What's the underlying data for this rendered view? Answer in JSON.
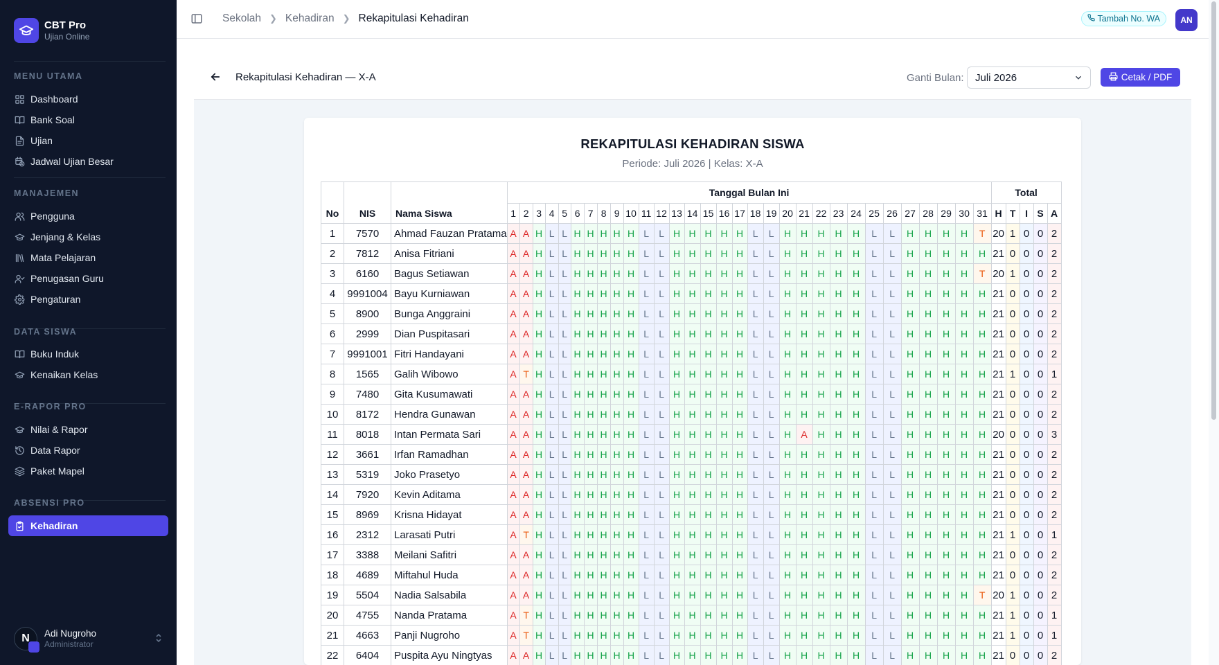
{
  "brand": {
    "title": "CBT Pro",
    "subtitle": "Ujian Online"
  },
  "sidebar": {
    "sections": [
      {
        "title": "MENU UTAMA",
        "items": [
          {
            "label": "Dashboard",
            "icon": "grid-icon"
          },
          {
            "label": "Bank Soal",
            "icon": "book-icon"
          },
          {
            "label": "Ujian",
            "icon": "document-icon"
          },
          {
            "label": "Jadwal Ujian Besar",
            "icon": "calendar-clock-icon"
          }
        ]
      },
      {
        "title": "MANAJEMEN",
        "items": [
          {
            "label": "Pengguna",
            "icon": "users-icon"
          },
          {
            "label": "Jenjang & Kelas",
            "icon": "graduation-cap-icon"
          },
          {
            "label": "Mata Pelajaran",
            "icon": "library-icon"
          },
          {
            "label": "Penugasan Guru",
            "icon": "user-check-icon"
          },
          {
            "label": "Pengaturan",
            "icon": "gear-icon"
          }
        ]
      },
      {
        "title": "DATA SISWA",
        "items": [
          {
            "label": "Buku Induk",
            "icon": "book-icon"
          },
          {
            "label": "Kenaikan Kelas",
            "icon": "graduation-cap-icon"
          }
        ]
      },
      {
        "title": "E-RAPOR PRO",
        "items": [
          {
            "label": "Nilai & Rapor",
            "icon": "graduation-cap-icon"
          },
          {
            "label": "Data Rapor",
            "icon": "history-icon"
          },
          {
            "label": "Paket Mapel",
            "icon": "layers-icon"
          }
        ]
      },
      {
        "title": "ABSENSI PRO",
        "items": [
          {
            "label": "Kehadiran",
            "icon": "clipboard-check-icon",
            "active": true
          }
        ]
      }
    ],
    "user": {
      "initial": "N",
      "name": "Adi Nugroho",
      "role": "Administrator"
    }
  },
  "topbar": {
    "breadcrumb": [
      "Sekolah",
      "Kehadiran",
      "Rekapitulasi Kehadiran"
    ],
    "wa_label": "Tambah No. WA",
    "avatar": "AN"
  },
  "header": {
    "title": "Rekapitulasi Kehadiran — X-A",
    "month_label": "Ganti Bulan:",
    "month_value": "Juli 2026",
    "print_label": "Cetak / PDF"
  },
  "report": {
    "title": "REKAPITULASI KEHADIRAN SISWA",
    "period": "Periode: Juli 2026 | Kelas: X-A",
    "headers": {
      "no": "No",
      "nis": "NIS",
      "name": "Nama Siswa",
      "days_group": "Tanggal Bulan Ini",
      "total_group": "Total"
    },
    "days": [
      "1",
      "2",
      "3",
      "4",
      "5",
      "6",
      "7",
      "8",
      "9",
      "10",
      "11",
      "12",
      "13",
      "14",
      "15",
      "16",
      "17",
      "18",
      "19",
      "20",
      "21",
      "22",
      "23",
      "24",
      "25",
      "26",
      "27",
      "28",
      "29",
      "30",
      "31"
    ],
    "total_keys": [
      "H",
      "T",
      "I",
      "S",
      "A"
    ],
    "rows": [
      {
        "no": "1",
        "nis": "7570",
        "name": "Ahmad Fauzan Pratama",
        "days": "AAHLLHHHHHLLHHHHHLLHHHHHLLHHHHT",
        "totals": [
          "20",
          "1",
          "0",
          "0",
          "2"
        ]
      },
      {
        "no": "2",
        "nis": "7812",
        "name": "Anisa Fitriani",
        "days": "AAHLLHHHHHLLHHHHHLLHHHHHLLHHHHH",
        "totals": [
          "21",
          "0",
          "0",
          "0",
          "2"
        ]
      },
      {
        "no": "3",
        "nis": "6160",
        "name": "Bagus Setiawan",
        "days": "AAHLLHHHHHLLHHHHHLLHHHHHLLHHHHT",
        "totals": [
          "20",
          "1",
          "0",
          "0",
          "2"
        ]
      },
      {
        "no": "4",
        "nis": "9991004",
        "name": "Bayu Kurniawan",
        "days": "AAHLLHHHHHLLHHHHHLLHHHHHLLHHHHH",
        "totals": [
          "21",
          "0",
          "0",
          "0",
          "2"
        ]
      },
      {
        "no": "5",
        "nis": "8900",
        "name": "Bunga Anggraini",
        "days": "AAHLLHHHHHLLHHHHHLLHHHHHLLHHHHH",
        "totals": [
          "21",
          "0",
          "0",
          "0",
          "2"
        ]
      },
      {
        "no": "6",
        "nis": "2999",
        "name": "Dian Puspitasari",
        "days": "AAHLLHHHHHLLHHHHHLLHHHHHLLHHHHH",
        "totals": [
          "21",
          "0",
          "0",
          "0",
          "2"
        ]
      },
      {
        "no": "7",
        "nis": "9991001",
        "name": "Fitri Handayani",
        "days": "AAHLLHHHHHLLHHHHHLLHHHHHLLHHHHH",
        "totals": [
          "21",
          "0",
          "0",
          "0",
          "2"
        ]
      },
      {
        "no": "8",
        "nis": "1565",
        "name": "Galih Wibowo",
        "days": "ATHLLHHHHHLLHHHHHLLHHHHHLLHHHHH",
        "totals": [
          "21",
          "1",
          "0",
          "0",
          "1"
        ]
      },
      {
        "no": "9",
        "nis": "7480",
        "name": "Gita Kusumawati",
        "days": "AAHLLHHHHHLLHHHHHLLHHHHHLLHHHHH",
        "totals": [
          "21",
          "0",
          "0",
          "0",
          "2"
        ]
      },
      {
        "no": "10",
        "nis": "8172",
        "name": "Hendra Gunawan",
        "days": "AAHLLHHHHHLLHHHHHLLHHHHHLLHHHHH",
        "totals": [
          "21",
          "0",
          "0",
          "0",
          "2"
        ]
      },
      {
        "no": "11",
        "nis": "8018",
        "name": "Intan Permata Sari",
        "days": "AAHLLHHHHHLLHHHHHLLHAHHHLLHHHHH",
        "totals": [
          "20",
          "0",
          "0",
          "0",
          "3"
        ]
      },
      {
        "no": "12",
        "nis": "3661",
        "name": "Irfan Ramadhan",
        "days": "AAHLLHHHHHLLHHHHHLLHHHHHLLHHHHH",
        "totals": [
          "21",
          "0",
          "0",
          "0",
          "2"
        ]
      },
      {
        "no": "13",
        "nis": "5319",
        "name": "Joko Prasetyo",
        "days": "AAHLLHHHHHLLHHHHHLLHHHHHLLHHHHH",
        "totals": [
          "21",
          "0",
          "0",
          "0",
          "2"
        ]
      },
      {
        "no": "14",
        "nis": "7920",
        "name": "Kevin Aditama",
        "days": "AAHLLHHHHHLLHHHHHLLHHHHHLLHHHHH",
        "totals": [
          "21",
          "0",
          "0",
          "0",
          "2"
        ]
      },
      {
        "no": "15",
        "nis": "8969",
        "name": "Krisna Hidayat",
        "days": "AAHLLHHHHHLLHHHHHLLHHHHHLLHHHHH",
        "totals": [
          "21",
          "0",
          "0",
          "0",
          "2"
        ]
      },
      {
        "no": "16",
        "nis": "2312",
        "name": "Larasati Putri",
        "days": "ATHLLHHHHHLLHHHHHLLHHHHHLLHHHHH",
        "totals": [
          "21",
          "1",
          "0",
          "0",
          "1"
        ]
      },
      {
        "no": "17",
        "nis": "3388",
        "name": "Meilani Safitri",
        "days": "AAHLLHHHHHLLHHHHHLLHHHHHLLHHHHH",
        "totals": [
          "21",
          "0",
          "0",
          "0",
          "2"
        ]
      },
      {
        "no": "18",
        "nis": "4689",
        "name": "Miftahul Huda",
        "days": "AAHLLHHHHHLLHHHHHLLHHHHHLLHHHHH",
        "totals": [
          "21",
          "0",
          "0",
          "0",
          "2"
        ]
      },
      {
        "no": "19",
        "nis": "5504",
        "name": "Nadia Salsabila",
        "days": "AAHLLHHHHHLLHHHHHLLHHHHHLLHHHHT",
        "totals": [
          "20",
          "1",
          "0",
          "0",
          "2"
        ]
      },
      {
        "no": "20",
        "nis": "4755",
        "name": "Nanda Pratama",
        "days": "ATHLLHHHHHLLHHHHHLLHHHHHLLHHHHH",
        "totals": [
          "21",
          "1",
          "0",
          "0",
          "1"
        ]
      },
      {
        "no": "21",
        "nis": "4663",
        "name": "Panji Nugroho",
        "days": "ATHLLHHHHHLLHHHHHLLHHHHHLLHHHHH",
        "totals": [
          "21",
          "1",
          "0",
          "0",
          "1"
        ]
      },
      {
        "no": "22",
        "nis": "6404",
        "name": "Puspita Ayu Ningtyas",
        "days": "AAHLLHHHHHLLHHHHHLLHHHHHLLHHHHH",
        "totals": [
          "21",
          "0",
          "0",
          "0",
          "2"
        ]
      }
    ]
  },
  "colors": {
    "accent": "#4f46e5",
    "sidebar_bg": "#0f172a",
    "present": "#16a34a",
    "absent": "#dc2626",
    "late": "#ea580c",
    "holiday": "#64748b"
  }
}
